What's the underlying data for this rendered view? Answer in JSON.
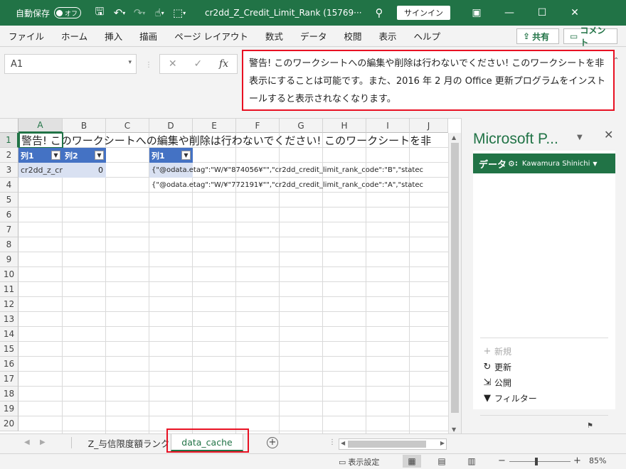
{
  "titlebar": {
    "autosave_label": "自動保存",
    "autosave_state": "オフ",
    "doc_title": "cr2dd_Z_Credit_Limit_Rank (15769···",
    "signin_label": "サインイン",
    "icons": [
      "save-icon",
      "undo-icon",
      "redo-icon",
      "touch-mode-icon",
      "customize-icon",
      "search-icon",
      "ribbon-display-icon",
      "minimize-icon",
      "maximize-icon",
      "close-icon"
    ]
  },
  "ribbon": {
    "tabs": [
      "ファイル",
      "ホーム",
      "挿入",
      "描画",
      "ページ レイアウト",
      "数式",
      "データ",
      "校閲",
      "表示",
      "ヘルプ"
    ],
    "share_label": "共有",
    "comment_label": "コメント"
  },
  "formula_bar": {
    "name_box": "A1",
    "fx_label": "fx",
    "content": "警告! このワークシートへの編集や削除は行わないでください! このワークシートを非表示にすることは可能です。また、2016 年 2 月の Office 更新プログラムをインストールすると表示されなくなります。"
  },
  "grid": {
    "columns": [
      "A",
      "B",
      "C",
      "D",
      "E",
      "F",
      "G",
      "H",
      "I",
      "J"
    ],
    "rows": [
      "1",
      "2",
      "3",
      "4",
      "5",
      "6",
      "7",
      "8",
      "9",
      "10",
      "11",
      "12",
      "13",
      "14",
      "15",
      "16",
      "17",
      "18",
      "19",
      "20"
    ],
    "a1": "警告! このワークシートへの編集や削除は行わないでください! このワークシートを非",
    "table1": {
      "header1": "列1",
      "header2": "列2",
      "cell_a3": "cr2dd_z_cr",
      "cell_b3": "0"
    },
    "table2": {
      "header": "列1",
      "d3": "{\"@odata.etag\":\"W/¥\"874056¥\"\",\"cr2dd_credit_limit_rank_code\":\"B\",\"statec",
      "d4": "{\"@odata.etag\":\"W/¥\"772191¥\"\",\"cr2dd_credit_limit_rank_code\":\"A\",\"statec"
    }
  },
  "pane": {
    "title": "Microsoft P...",
    "data_label": "データ",
    "user": "Kawamura Shinichi",
    "actions": [
      {
        "label": "新規",
        "icon": "plus-icon",
        "enabled": false
      },
      {
        "label": "更新",
        "icon": "refresh-icon",
        "enabled": true
      },
      {
        "label": "公開",
        "icon": "publish-icon",
        "enabled": true
      },
      {
        "label": "フィルター",
        "icon": "filter-icon",
        "enabled": true
      }
    ]
  },
  "sheets": {
    "tabs": [
      "Z_与信限度額ランク",
      "data_cache"
    ],
    "active": "data_cache"
  },
  "status": {
    "display_settings": "表示設定",
    "zoom": "85%"
  },
  "colors": {
    "accent": "#217346",
    "highlight": "#e81123",
    "table_header": "#4472c4",
    "table_band": "#d9e1f2"
  }
}
